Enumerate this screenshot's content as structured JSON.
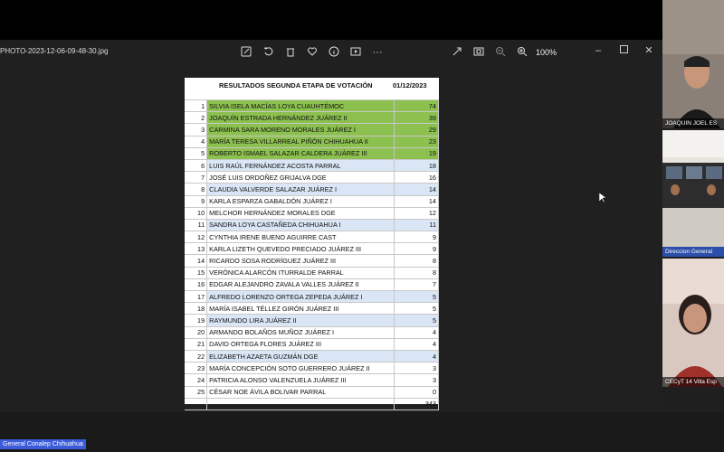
{
  "viewer": {
    "file_name": "PHOTO-2023-12-06-09-48-30.jpg",
    "zoom": "100%"
  },
  "sheet": {
    "title": "RESULTADOS SEGUNDA ETAPA DE VOTACIÓN",
    "date": "01/12/2023",
    "total": "343",
    "rows": [
      {
        "n": "1",
        "name": "SILVIA ISELA  MACÍAS LOYA    CUAUHTÉMOC",
        "votes": "74",
        "hl": "green"
      },
      {
        "n": "2",
        "name": "JOAQUÍN  ESTRADA HERNÁNDEZ    JUÁREZ II",
        "votes": "39",
        "hl": "green"
      },
      {
        "n": "3",
        "name": "CARMINA  SARA MORENO MORALES   JUÁREZ I",
        "votes": "29",
        "hl": "green"
      },
      {
        "n": "4",
        "name": "MARÍA TERESA VILLARREAL PIÑÓN CHIHUAHUA II",
        "votes": "23",
        "hl": "green"
      },
      {
        "n": "5",
        "name": "ROBERTO ISMAEL SALAZAR CALDERA JUÁREZ III",
        "votes": "19",
        "hl": "green"
      },
      {
        "n": "6",
        "name": "LUIS RAÚL FERNÁNDEZ ACOSTA    PARRAL",
        "votes": "18",
        "hl": "blue"
      },
      {
        "n": "7",
        "name": "JOSÉ LUIS ORDOÑEZ GRIJALVA    DGE",
        "votes": "16",
        "hl": ""
      },
      {
        "n": "8",
        "name": "CLAUDIA VALVERDE  SALAZAR   JUÁREZ I",
        "votes": "14",
        "hl": "blue"
      },
      {
        "n": "9",
        "name": "KARLA ESPARZA GABALDÓN    JUÁREZ I",
        "votes": "14",
        "hl": ""
      },
      {
        "n": "10",
        "name": "MELCHOR HERNÁNDEZ MORALES    DGE",
        "votes": "12",
        "hl": ""
      },
      {
        "n": "11",
        "name": "SANDRA LOYA CASTAÑEDA    CHIHUAHUA I",
        "votes": "11",
        "hl": "blue"
      },
      {
        "n": "12",
        "name": "CYNTHIA IRENE BUENO AGUIRRE    CAST",
        "votes": "9",
        "hl": ""
      },
      {
        "n": "13",
        "name": "KARLA  LIZETH QUEVEDO PRECIADO   JUÁREZ III",
        "votes": "9",
        "hl": ""
      },
      {
        "n": "14",
        "name": "RICARDO SOSA RODRÍGUEZ   JUÁREZ III",
        "votes": "8",
        "hl": ""
      },
      {
        "n": "15",
        "name": "VERÓNICA ALARCÓN ITURRALDE    PARRAL",
        "votes": "8",
        "hl": ""
      },
      {
        "n": "16",
        "name": "EDGAR ALEJANDRO  ZAVALA VALLES   JUÁREZ II",
        "votes": "7",
        "hl": ""
      },
      {
        "n": "17",
        "name": "ALFREDO LORENZO ORTEGA ZEPEDA   JUÁREZ I",
        "votes": "5",
        "hl": "blue"
      },
      {
        "n": "18",
        "name": "MARÍA ISABEL TÉLLEZ GIRÓN    JUÁREZ III",
        "votes": "5",
        "hl": ""
      },
      {
        "n": "19",
        "name": "RAYMUNDO LIRA    JUÁREZ II",
        "votes": "5",
        "hl": "blue"
      },
      {
        "n": "20",
        "name": "ARMANDO BOLAÑOS MUÑOZ    JUÁREZ I",
        "votes": "4",
        "hl": ""
      },
      {
        "n": "21",
        "name": "DAVID ORTEGA FLORES    JUÁREZ III",
        "votes": "4",
        "hl": ""
      },
      {
        "n": "22",
        "name": "ELIZABETH AZAETA GUZMÁN    DGE",
        "votes": "4",
        "hl": "blue"
      },
      {
        "n": "23",
        "name": "MARÍA CONCEPCIÓN  SOTO GUERRERO   JUÁREZ II",
        "votes": "3",
        "hl": ""
      },
      {
        "n": "24",
        "name": "PATRICIA  ALONSO VALENZUELA    JUÁREZ III",
        "votes": "3",
        "hl": ""
      },
      {
        "n": "25",
        "name": "CÉSAR NOE ÁVILA BOLIVAR PARRAL",
        "votes": "0",
        "hl": ""
      }
    ]
  },
  "participants": [
    {
      "label": "JOAQUIN JOEL ES"
    },
    {
      "label": "Direccion  General"
    },
    {
      "label": "CECyT 14 Villa Esp"
    }
  ],
  "bottom": {
    "presenter_label": "General Conalep Chihuahua"
  },
  "colors": {
    "green_row": "#8cc04f",
    "blue_row": "#dae6f5",
    "presenter_badge": "#3b5bdb"
  },
  "icons": [
    "edit-icon",
    "rotate-icon",
    "delete-icon",
    "heart-icon",
    "info-icon",
    "slideshow-icon",
    "more-icon",
    "expand-icon",
    "fit-icon",
    "zoom-out-icon",
    "zoom-in-icon",
    "minimize-icon",
    "maximize-icon",
    "close-icon"
  ]
}
